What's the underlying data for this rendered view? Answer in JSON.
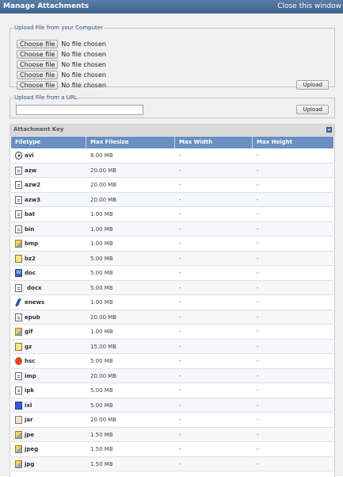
{
  "title": "Manage Attachments",
  "close_label": "Close this window",
  "upload_computer": {
    "legend": "Upload File from your Computer",
    "choose_label": "Choose file",
    "no_file_label": "No file chosen",
    "upload_label": "Upload"
  },
  "upload_url": {
    "legend": "Upload File from a URL",
    "value": "",
    "upload_label": "Upload"
  },
  "attachment_key": {
    "title": "Attachment Key",
    "columns": [
      "Filetype",
      "Max Filesize",
      "Max Width",
      "Max Height"
    ],
    "rows": [
      {
        "ext": "avi",
        "size": "8.00 MB",
        "width": "-",
        "height": "-",
        "icon": "media-icon"
      },
      {
        "ext": "azw",
        "size": "20.00 MB",
        "width": "-",
        "height": "-",
        "icon": "document-icon"
      },
      {
        "ext": "azw2",
        "size": "20.00 MB",
        "width": "-",
        "height": "-",
        "icon": "document-icon"
      },
      {
        "ext": "azw3",
        "size": "20.00 MB",
        "width": "-",
        "height": "-",
        "icon": "document-icon"
      },
      {
        "ext": "bat",
        "size": "1.00 MB",
        "width": "-",
        "height": "-",
        "icon": "document-icon"
      },
      {
        "ext": "bin",
        "size": "1.00 MB",
        "width": "-",
        "height": "-",
        "icon": "document-icon"
      },
      {
        "ext": "bmp",
        "size": "1.00 MB",
        "width": "-",
        "height": "-",
        "icon": "image-icon"
      },
      {
        "ext": "bz2",
        "size": "5.00 MB",
        "width": "-",
        "height": "-",
        "icon": "archive-icon"
      },
      {
        "ext": "doc",
        "size": "5.00 MB",
        "width": "-",
        "height": "-",
        "icon": "word-icon"
      },
      {
        "ext": "docx",
        "size": "5.00 MB",
        "width": "-",
        "height": "-",
        "icon": "broken-image-icon"
      },
      {
        "ext": "enews",
        "size": "1.00 MB",
        "width": "-",
        "height": "-",
        "icon": "feather-icon"
      },
      {
        "ext": "epub",
        "size": "20.00 MB",
        "width": "-",
        "height": "-",
        "icon": "document-icon"
      },
      {
        "ext": "gif",
        "size": "1.00 MB",
        "width": "-",
        "height": "-",
        "icon": "image-icon"
      },
      {
        "ext": "gz",
        "size": "15.00 MB",
        "width": "-",
        "height": "-",
        "icon": "archive-icon"
      },
      {
        "ext": "hsc",
        "size": "5.00 MB",
        "width": "-",
        "height": "-",
        "icon": "help-icon"
      },
      {
        "ext": "imp",
        "size": "20.00 MB",
        "width": "-",
        "height": "-",
        "icon": "document-icon"
      },
      {
        "ext": "ipk",
        "size": "5.00 MB",
        "width": "-",
        "height": "-",
        "icon": "document-icon"
      },
      {
        "ext": "ixl",
        "size": "5.00 MB",
        "width": "-",
        "height": "-",
        "icon": "database-icon"
      },
      {
        "ext": "jar",
        "size": "20.00 MB",
        "width": "-",
        "height": "-",
        "icon": "jar-icon"
      },
      {
        "ext": "jpe",
        "size": "1.50 MB",
        "width": "-",
        "height": "-",
        "icon": "image-icon"
      },
      {
        "ext": "jpeg",
        "size": "1.50 MB",
        "width": "-",
        "height": "-",
        "icon": "image-icon"
      },
      {
        "ext": "jpg",
        "size": "1.50 MB",
        "width": "-",
        "height": "-",
        "icon": "image-icon"
      }
    ]
  }
}
